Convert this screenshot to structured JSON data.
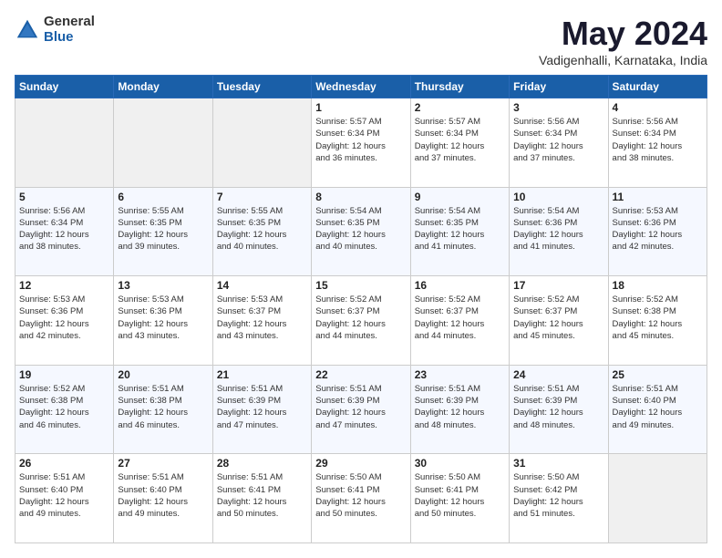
{
  "logo": {
    "general": "General",
    "blue": "Blue"
  },
  "header": {
    "title": "May 2024",
    "subtitle": "Vadigenhalli, Karnataka, India"
  },
  "days_of_week": [
    "Sunday",
    "Monday",
    "Tuesday",
    "Wednesday",
    "Thursday",
    "Friday",
    "Saturday"
  ],
  "weeks": [
    [
      {
        "day": "",
        "info": ""
      },
      {
        "day": "",
        "info": ""
      },
      {
        "day": "",
        "info": ""
      },
      {
        "day": "1",
        "info": "Sunrise: 5:57 AM\nSunset: 6:34 PM\nDaylight: 12 hours\nand 36 minutes."
      },
      {
        "day": "2",
        "info": "Sunrise: 5:57 AM\nSunset: 6:34 PM\nDaylight: 12 hours\nand 37 minutes."
      },
      {
        "day": "3",
        "info": "Sunrise: 5:56 AM\nSunset: 6:34 PM\nDaylight: 12 hours\nand 37 minutes."
      },
      {
        "day": "4",
        "info": "Sunrise: 5:56 AM\nSunset: 6:34 PM\nDaylight: 12 hours\nand 38 minutes."
      }
    ],
    [
      {
        "day": "5",
        "info": "Sunrise: 5:56 AM\nSunset: 6:34 PM\nDaylight: 12 hours\nand 38 minutes."
      },
      {
        "day": "6",
        "info": "Sunrise: 5:55 AM\nSunset: 6:35 PM\nDaylight: 12 hours\nand 39 minutes."
      },
      {
        "day": "7",
        "info": "Sunrise: 5:55 AM\nSunset: 6:35 PM\nDaylight: 12 hours\nand 40 minutes."
      },
      {
        "day": "8",
        "info": "Sunrise: 5:54 AM\nSunset: 6:35 PM\nDaylight: 12 hours\nand 40 minutes."
      },
      {
        "day": "9",
        "info": "Sunrise: 5:54 AM\nSunset: 6:35 PM\nDaylight: 12 hours\nand 41 minutes."
      },
      {
        "day": "10",
        "info": "Sunrise: 5:54 AM\nSunset: 6:36 PM\nDaylight: 12 hours\nand 41 minutes."
      },
      {
        "day": "11",
        "info": "Sunrise: 5:53 AM\nSunset: 6:36 PM\nDaylight: 12 hours\nand 42 minutes."
      }
    ],
    [
      {
        "day": "12",
        "info": "Sunrise: 5:53 AM\nSunset: 6:36 PM\nDaylight: 12 hours\nand 42 minutes."
      },
      {
        "day": "13",
        "info": "Sunrise: 5:53 AM\nSunset: 6:36 PM\nDaylight: 12 hours\nand 43 minutes."
      },
      {
        "day": "14",
        "info": "Sunrise: 5:53 AM\nSunset: 6:37 PM\nDaylight: 12 hours\nand 43 minutes."
      },
      {
        "day": "15",
        "info": "Sunrise: 5:52 AM\nSunset: 6:37 PM\nDaylight: 12 hours\nand 44 minutes."
      },
      {
        "day": "16",
        "info": "Sunrise: 5:52 AM\nSunset: 6:37 PM\nDaylight: 12 hours\nand 44 minutes."
      },
      {
        "day": "17",
        "info": "Sunrise: 5:52 AM\nSunset: 6:37 PM\nDaylight: 12 hours\nand 45 minutes."
      },
      {
        "day": "18",
        "info": "Sunrise: 5:52 AM\nSunset: 6:38 PM\nDaylight: 12 hours\nand 45 minutes."
      }
    ],
    [
      {
        "day": "19",
        "info": "Sunrise: 5:52 AM\nSunset: 6:38 PM\nDaylight: 12 hours\nand 46 minutes."
      },
      {
        "day": "20",
        "info": "Sunrise: 5:51 AM\nSunset: 6:38 PM\nDaylight: 12 hours\nand 46 minutes."
      },
      {
        "day": "21",
        "info": "Sunrise: 5:51 AM\nSunset: 6:39 PM\nDaylight: 12 hours\nand 47 minutes."
      },
      {
        "day": "22",
        "info": "Sunrise: 5:51 AM\nSunset: 6:39 PM\nDaylight: 12 hours\nand 47 minutes."
      },
      {
        "day": "23",
        "info": "Sunrise: 5:51 AM\nSunset: 6:39 PM\nDaylight: 12 hours\nand 48 minutes."
      },
      {
        "day": "24",
        "info": "Sunrise: 5:51 AM\nSunset: 6:39 PM\nDaylight: 12 hours\nand 48 minutes."
      },
      {
        "day": "25",
        "info": "Sunrise: 5:51 AM\nSunset: 6:40 PM\nDaylight: 12 hours\nand 49 minutes."
      }
    ],
    [
      {
        "day": "26",
        "info": "Sunrise: 5:51 AM\nSunset: 6:40 PM\nDaylight: 12 hours\nand 49 minutes."
      },
      {
        "day": "27",
        "info": "Sunrise: 5:51 AM\nSunset: 6:40 PM\nDaylight: 12 hours\nand 49 minutes."
      },
      {
        "day": "28",
        "info": "Sunrise: 5:51 AM\nSunset: 6:41 PM\nDaylight: 12 hours\nand 50 minutes."
      },
      {
        "day": "29",
        "info": "Sunrise: 5:50 AM\nSunset: 6:41 PM\nDaylight: 12 hours\nand 50 minutes."
      },
      {
        "day": "30",
        "info": "Sunrise: 5:50 AM\nSunset: 6:41 PM\nDaylight: 12 hours\nand 50 minutes."
      },
      {
        "day": "31",
        "info": "Sunrise: 5:50 AM\nSunset: 6:42 PM\nDaylight: 12 hours\nand 51 minutes."
      },
      {
        "day": "",
        "info": ""
      }
    ]
  ]
}
